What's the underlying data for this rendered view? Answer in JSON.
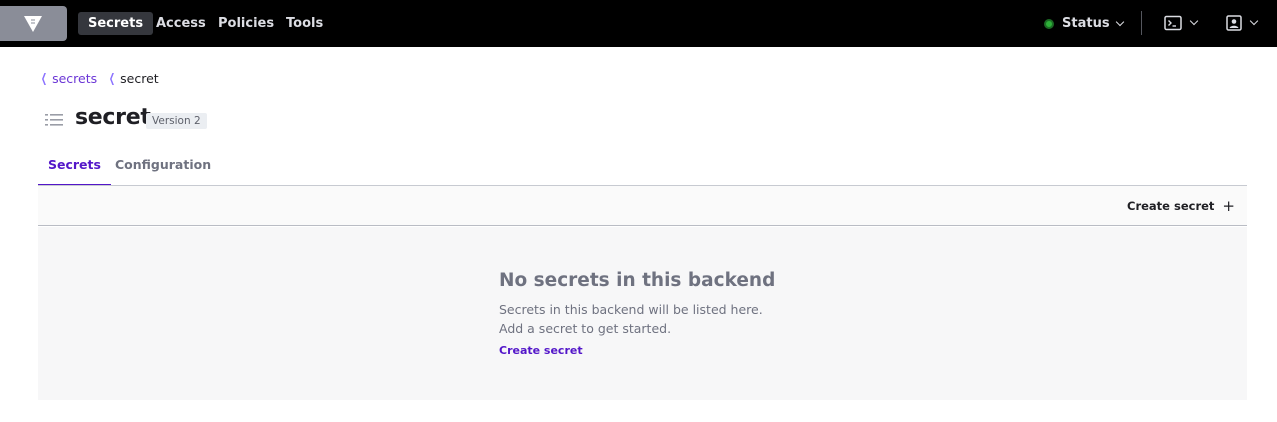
{
  "nav": {
    "logo_icon": "vault-triangle-logo",
    "items": [
      {
        "label": "Secrets",
        "active": true
      },
      {
        "label": "Access",
        "active": false
      },
      {
        "label": "Policies",
        "active": false
      },
      {
        "label": "Tools",
        "active": false
      }
    ],
    "status_label": "Status",
    "status_color": "#2eb039",
    "console_icon": "terminal-icon",
    "user_icon": "user-square-icon"
  },
  "breadcrumb": {
    "parent_label": "secrets",
    "current_label": "secret"
  },
  "header": {
    "title": "secret",
    "version_badge": "Version 2",
    "icon": "list-icon"
  },
  "tabs": [
    {
      "label": "Secrets",
      "active": true
    },
    {
      "label": "Configuration",
      "active": false
    }
  ],
  "toolbar": {
    "create_label": "Create secret",
    "create_icon": "plus"
  },
  "empty_state": {
    "title": "No secrets in this backend",
    "message": "Secrets in this backend will be listed here. Add a secret to get started.",
    "link_label": "Create secret"
  },
  "colors": {
    "accent": "#5316c9",
    "nav_background": "#000000"
  }
}
